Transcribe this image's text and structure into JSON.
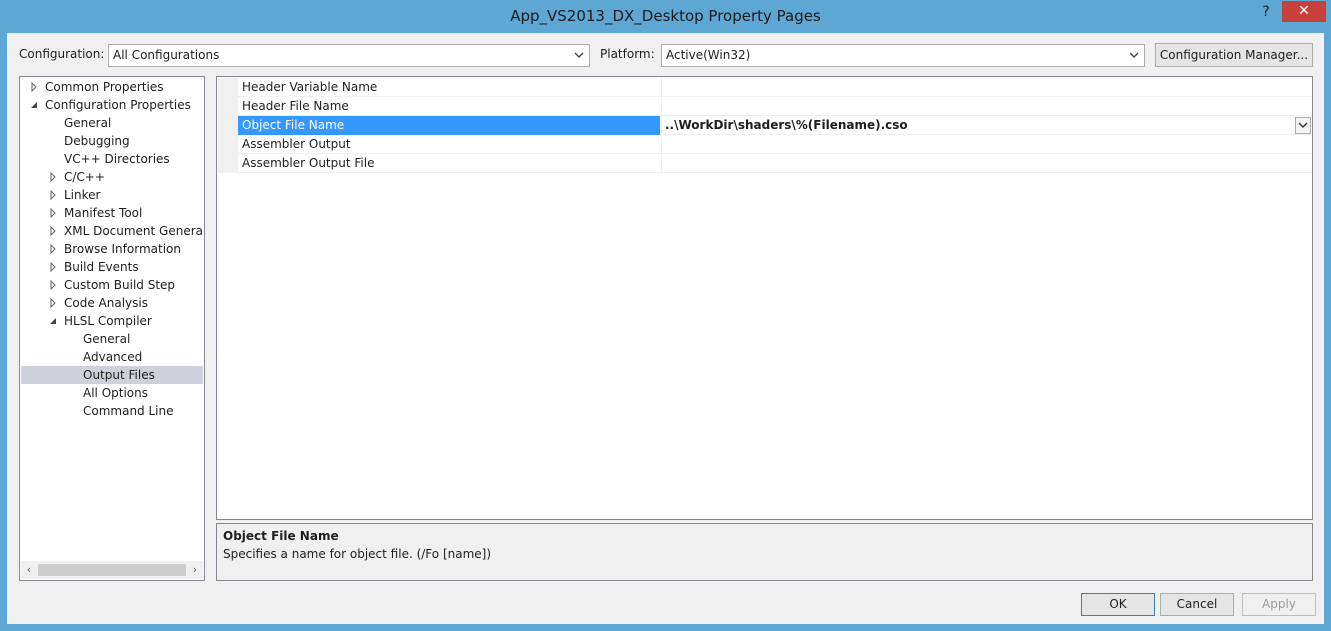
{
  "window": {
    "title": "App_VS2013_DX_Desktop Property Pages",
    "help_label": "?",
    "close_label": "✕"
  },
  "toolbar": {
    "configuration_label": "Configuration:",
    "configuration_value": "All Configurations",
    "platform_label": "Platform:",
    "platform_value": "Active(Win32)",
    "config_manager_label": "Configuration Manager..."
  },
  "tree": {
    "items": [
      {
        "label": "Common Properties",
        "depth": 0,
        "expander": "collapsed"
      },
      {
        "label": "Configuration Properties",
        "depth": 0,
        "expander": "expanded"
      },
      {
        "label": "General",
        "depth": 1,
        "expander": "none"
      },
      {
        "label": "Debugging",
        "depth": 1,
        "expander": "none"
      },
      {
        "label": "VC++ Directories",
        "depth": 1,
        "expander": "none"
      },
      {
        "label": "C/C++",
        "depth": 1,
        "expander": "collapsed"
      },
      {
        "label": "Linker",
        "depth": 1,
        "expander": "collapsed"
      },
      {
        "label": "Manifest Tool",
        "depth": 1,
        "expander": "collapsed"
      },
      {
        "label": "XML Document Generator",
        "depth": 1,
        "expander": "collapsed"
      },
      {
        "label": "Browse Information",
        "depth": 1,
        "expander": "collapsed"
      },
      {
        "label": "Build Events",
        "depth": 1,
        "expander": "collapsed"
      },
      {
        "label": "Custom Build Step",
        "depth": 1,
        "expander": "collapsed"
      },
      {
        "label": "Code Analysis",
        "depth": 1,
        "expander": "collapsed"
      },
      {
        "label": "HLSL Compiler",
        "depth": 1,
        "expander": "expanded"
      },
      {
        "label": "General",
        "depth": 2,
        "expander": "none"
      },
      {
        "label": "Advanced",
        "depth": 2,
        "expander": "none"
      },
      {
        "label": "Output Files",
        "depth": 2,
        "expander": "none",
        "selected": true
      },
      {
        "label": "All Options",
        "depth": 2,
        "expander": "none"
      },
      {
        "label": "Command Line",
        "depth": 2,
        "expander": "none"
      }
    ]
  },
  "properties": {
    "rows": [
      {
        "name": "Header Variable Name",
        "value": ""
      },
      {
        "name": "Header File Name",
        "value": ""
      },
      {
        "name": "Object File Name",
        "value": "..\\WorkDir\\shaders\\%(Filename).cso",
        "selected": true
      },
      {
        "name": "Assembler Output",
        "value": ""
      },
      {
        "name": "Assembler Output File",
        "value": ""
      }
    ]
  },
  "description": {
    "title": "Object File Name",
    "text": "Specifies a name for object file. (/Fo [name])"
  },
  "buttons": {
    "ok": "OK",
    "cancel": "Cancel",
    "apply": "Apply"
  },
  "colors": {
    "selection": "#3399ff",
    "tree_selection": "#cfd1da",
    "frame": "#5ea6d3",
    "close": "#c7413b"
  }
}
